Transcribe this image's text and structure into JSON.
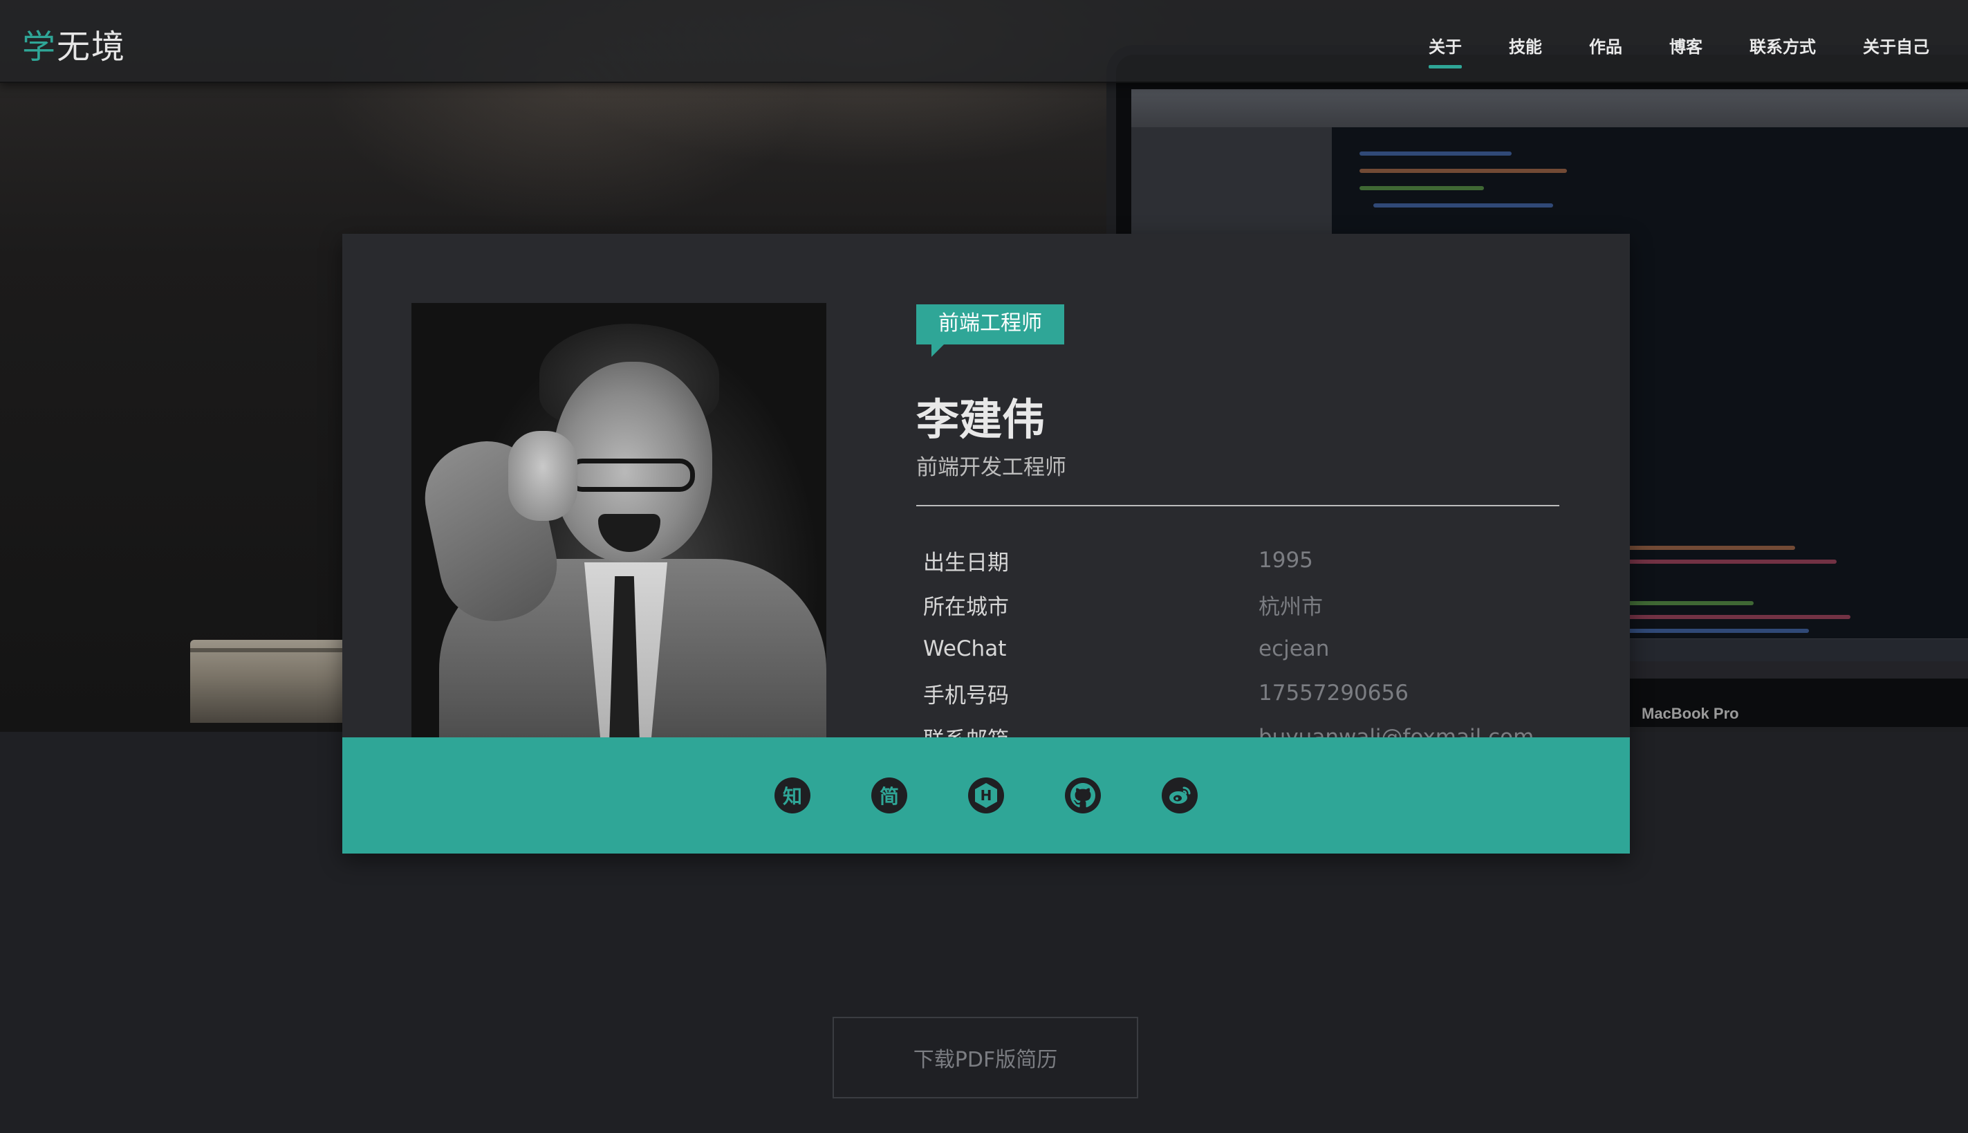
{
  "brand": {
    "accent": "学",
    "rest": "无境"
  },
  "nav": {
    "items": [
      "关于",
      "技能",
      "作品",
      "博客",
      "联系方式",
      "关于自己"
    ],
    "active_index": 0
  },
  "hero": {
    "laptop_label": "MacBook Pro"
  },
  "profile": {
    "badge": "前端工程师",
    "name": "李建伟",
    "subtitle": "前端开发工程师",
    "info": [
      {
        "label": "出生日期",
        "value": "1995"
      },
      {
        "label": "所在城市",
        "value": "杭州市"
      },
      {
        "label": "WeChat",
        "value": "ecjean"
      },
      {
        "label": "手机号码",
        "value": "17557290656"
      },
      {
        "label": "联系邮箱",
        "value": "buyuanwali@foxmail.com"
      }
    ]
  },
  "social": [
    {
      "icon": "zhihu-icon",
      "glyph": "知"
    },
    {
      "icon": "jianshu-icon",
      "glyph": "简"
    },
    {
      "icon": "hexo-icon",
      "glyph": "H"
    },
    {
      "icon": "github-icon",
      "glyph": ""
    },
    {
      "icon": "weibo-icon",
      "glyph": ""
    }
  ],
  "download_button": "下载PDF版简历",
  "colors": {
    "accent": "#2fa697",
    "background": "#1f2024",
    "card": "#292a2e"
  }
}
